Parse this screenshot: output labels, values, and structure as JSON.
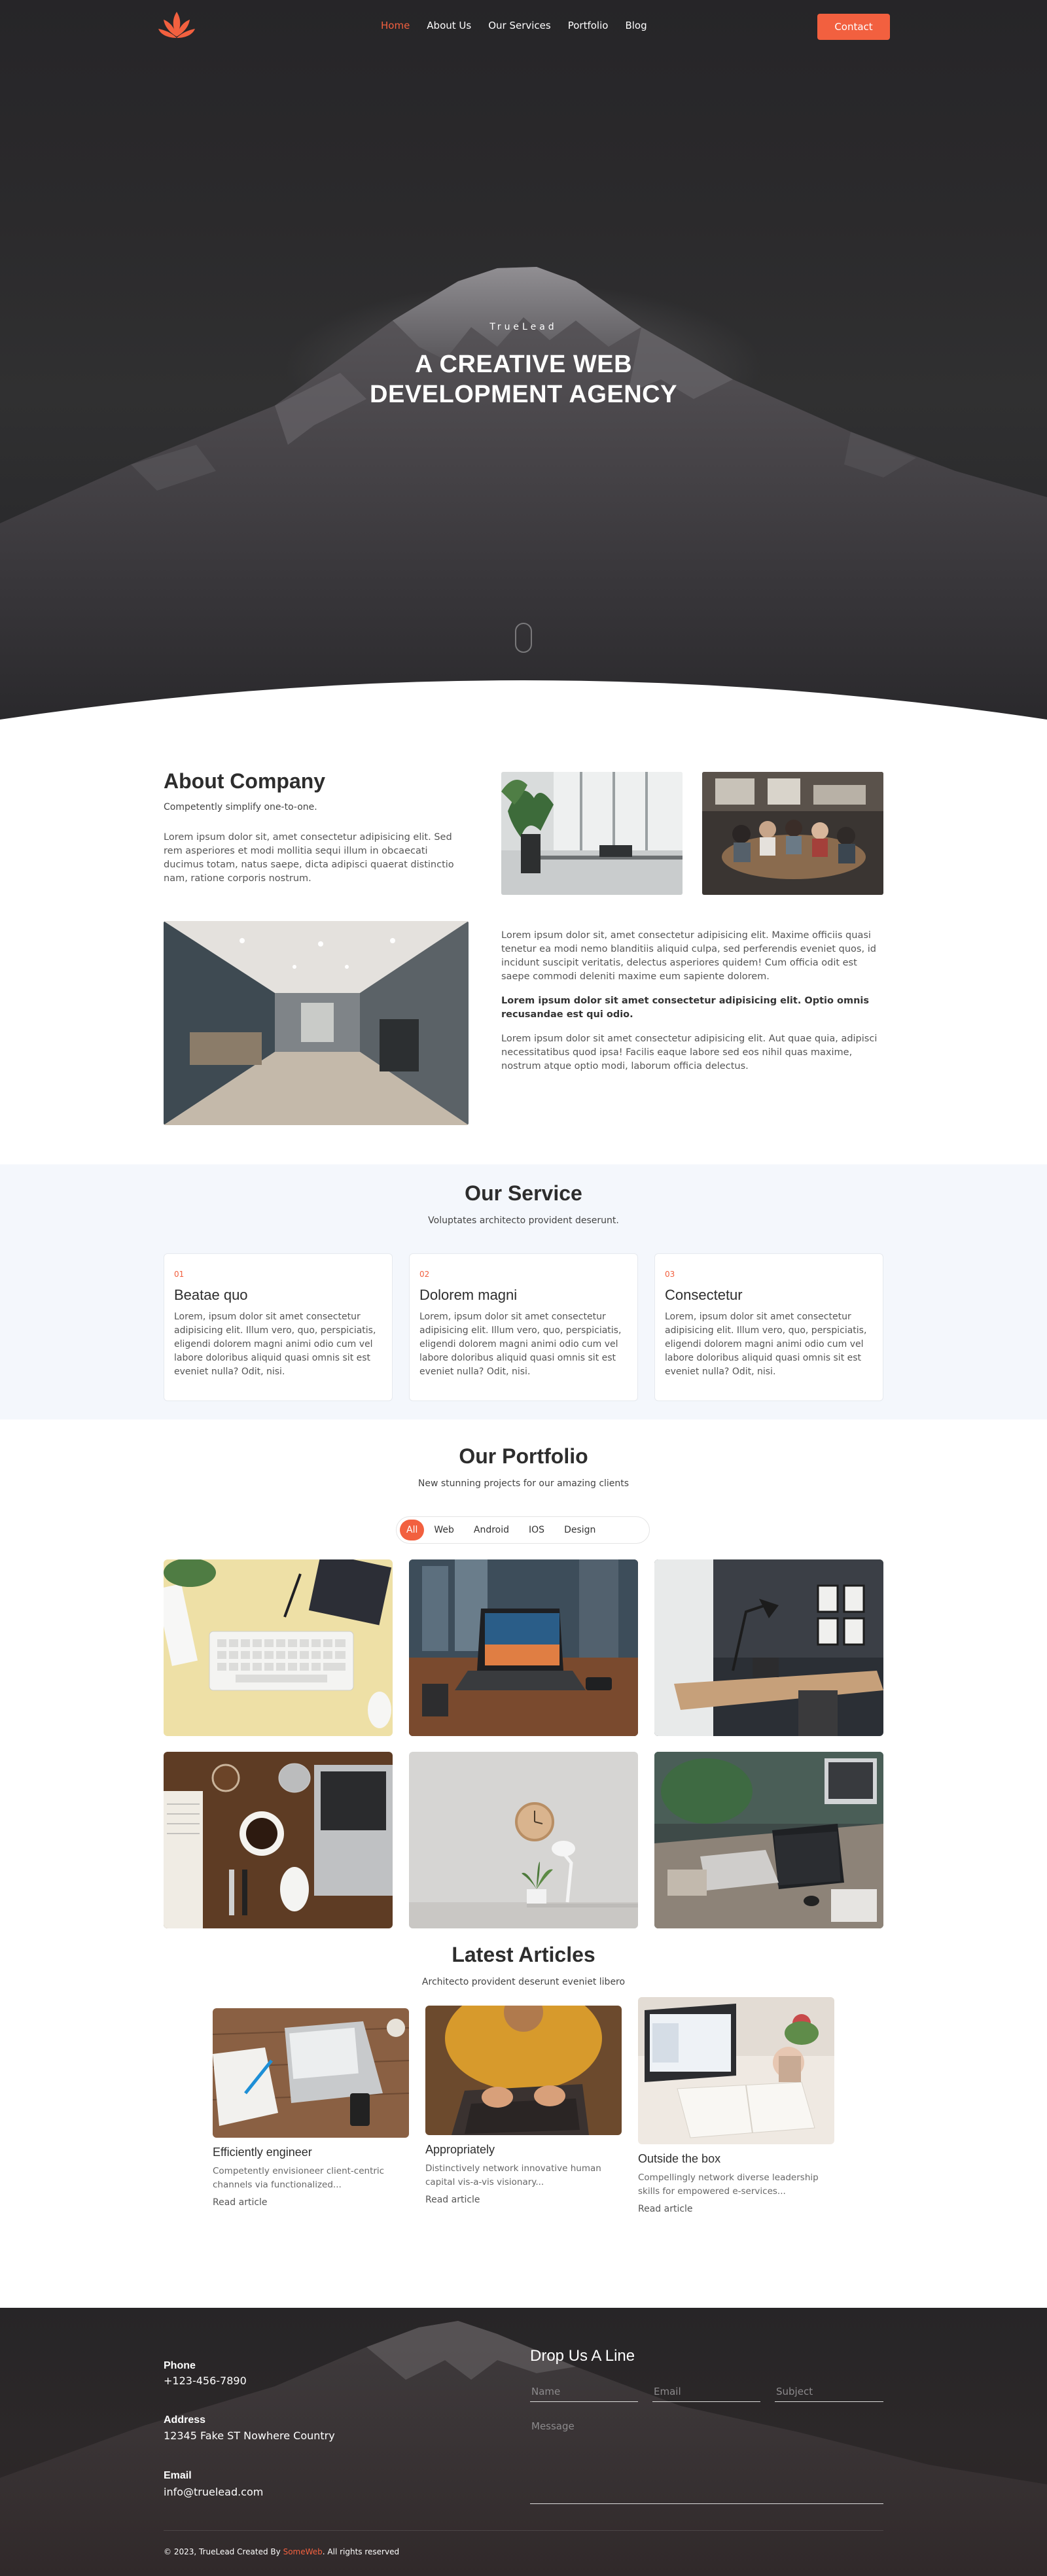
{
  "nav": {
    "logo_icon": "lotus-logo-icon",
    "links": [
      "Home",
      "About Us",
      "Our Services",
      "Portfolio",
      "Blog"
    ],
    "active": "Home",
    "contact_label": "Contact",
    "accent": "#f2603f"
  },
  "hero": {
    "eyebrow": "TrueLead",
    "title_line1": "A CREATIVE WEB",
    "title_line2": "DEVELOPMENT AGENCY"
  },
  "about": {
    "title": "About Company",
    "subtitle": "Competently simplify one-to-one.",
    "text1": "Lorem ipsum dolor sit, amet consectetur adipisicing elit. Sed rem asperiores et modi mollitia sequi illum in obcaecati ducimus totam, natus saepe, dicta adipisci quaerat distinctio nam, ratione corporis nostrum.",
    "text2": "Lorem ipsum dolor sit, amet consectetur adipisicing elit. Maxime officiis quasi tenetur ea modi nemo blanditiis aliquid culpa, sed perferendis eveniet quos, id incidunt suscipit veritatis, delectus asperiores quidem! Cum officia odit est saepe commodi deleniti maxime eum sapiente dolorem.",
    "text3": "Lorem ipsum dolor sit amet consectetur adipisicing elit. Optio omnis recusandae est qui odio.",
    "text4": "Lorem ipsum dolor sit amet consectetur adipisicing elit. Aut quae quia, adipisci necessitatibus quod ipsa! Facilis eaque labore sed eos nihil quas maxime, nostrum atque optio modi, laborum officia delectus."
  },
  "service": {
    "title": "Our Service",
    "subtitle": "Voluptates architecto provident deserunt.",
    "cards": [
      {
        "num": "01",
        "name": "Beatae quo",
        "desc": "Lorem, ipsum dolor sit amet consectetur adipisicing elit. Illum vero, quo, perspiciatis, eligendi dolorem magni animi odio cum vel labore doloribus aliquid quasi omnis sit est eveniet nulla? Odit, nisi."
      },
      {
        "num": "02",
        "name": "Dolorem magni",
        "desc": "Lorem, ipsum dolor sit amet consectetur adipisicing elit. Illum vero, quo, perspiciatis, eligendi dolorem magni animi odio cum vel labore doloribus aliquid quasi omnis sit est eveniet nulla? Odit, nisi."
      },
      {
        "num": "03",
        "name": "Consectetur",
        "desc": "Lorem, ipsum dolor sit amet consectetur adipisicing elit. Illum vero, quo, perspiciatis, eligendi dolorem magni animi odio cum vel labore doloribus aliquid quasi omnis sit est eveniet nulla? Odit, nisi."
      }
    ]
  },
  "portfolio": {
    "title": "Our Portfolio",
    "subtitle": "New stunning projects for our amazing clients",
    "filters": [
      "All",
      "Web",
      "Android",
      "IOS",
      "Design"
    ],
    "active_filter": "All"
  },
  "articles": {
    "title": "Latest Articles",
    "subtitle": "Architecto provident deserunt eveniet libero",
    "items": [
      {
        "title": "Efficiently engineer",
        "desc1": "Competently envisioneer client-centric",
        "desc2": "channels via functionalized...",
        "link": "Read article"
      },
      {
        "title": "Appropriately",
        "desc1": "Distinctively network innovative human",
        "desc2": "capital vis-a-vis visionary...",
        "link": "Read article"
      },
      {
        "title": "Outside the box",
        "desc1": "Compellingly network diverse leadership",
        "desc2": "skills for empowered e-services...",
        "link": "Read article"
      }
    ]
  },
  "footer": {
    "phone_label": "Phone",
    "phone_value": "+123-456-7890",
    "address_label": "Address",
    "address_value": "12345 Fake ST Nowhere Country",
    "email_label": "Email",
    "email_value": "info@truelead.com",
    "form_title": "Drop Us A Line",
    "name_placeholder": "Name",
    "email_placeholder": "Email",
    "subject_placeholder": "Subject",
    "message_placeholder": "Message",
    "copyright_pre": "© 2023, TrueLead Created By ",
    "copyright_brand": "SomeWeb",
    "copyright_post": ". All rights reserved"
  }
}
